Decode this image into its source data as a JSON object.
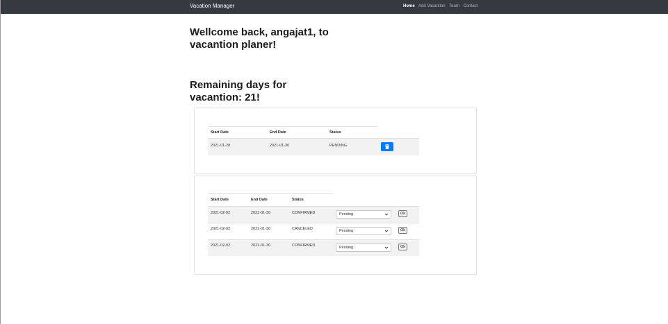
{
  "nav": {
    "brand": "Vacation Manager",
    "links": [
      "Home",
      "Add Vacantion",
      "Team",
      "Contact"
    ]
  },
  "welcome_text": "Wellcome back, angajat1, to vacantion planer!",
  "remaining_text": "Remaining days for vacantion: 21!",
  "my_vacations": {
    "headers": [
      "Start Date",
      "End Date",
      "Status"
    ],
    "rows": [
      {
        "start": "2021-01-28",
        "end": "2021-01-30",
        "status": "PENDING"
      }
    ]
  },
  "team_requests": {
    "headers": [
      "Start Date",
      "End Date",
      "Status"
    ],
    "rows": [
      {
        "start": "2021-02-02",
        "end": "2021-01-30",
        "status": "CONFIRMED",
        "select_value": "Pending",
        "ok_label": "Ok"
      },
      {
        "start": "2021-02-02",
        "end": "2021-01-30",
        "status": "CANCELED",
        "select_value": "Pending",
        "ok_label": "Ok"
      },
      {
        "start": "2021-02-02",
        "end": "2021-01-30",
        "status": "CONFIRMED",
        "select_value": "Pending",
        "ok_label": "Ok"
      }
    ]
  },
  "colors": {
    "navbar_bg": "#343a40",
    "primary_button": "#007bff",
    "row_stripe": "#f2f2f2"
  },
  "icons": {
    "delete": "trash-icon",
    "select_arrow": "chevron-down-icon"
  }
}
